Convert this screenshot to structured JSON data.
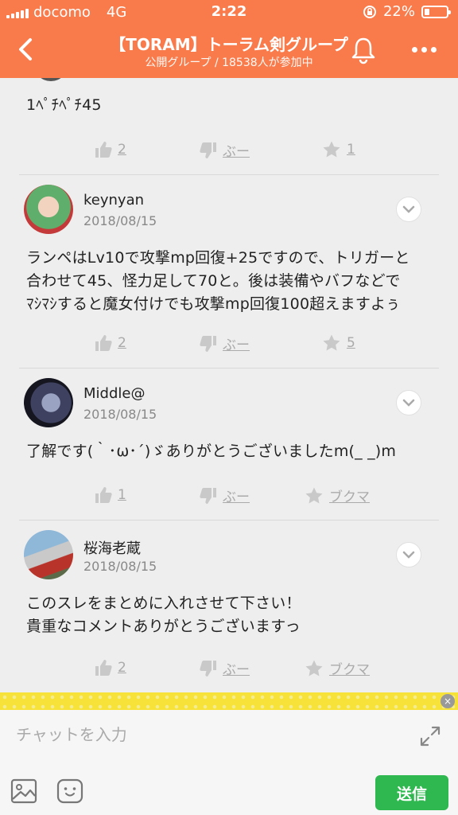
{
  "status": {
    "carrier": "docomo",
    "network": "4G",
    "time": "2:22",
    "battery": "22%",
    "battery_level": 0.22
  },
  "header": {
    "title": "【TORAM】トーラム剣グループ",
    "subtitle": "公開グループ / 18538人が参加中"
  },
  "posts": [
    {
      "text": "1ﾍﾟﾁﾍﾟﾁ45",
      "like_count": "2",
      "dislike_label": "ぶー",
      "bookmark_label": "1"
    },
    {
      "username": "keynyan",
      "date": "2018/08/15",
      "text_lines": [
        "ランペはLv10で攻撃mp回復+25ですので、トリガーと",
        "合わせて45、怪力足して70と。後は装備やバフなどで",
        "ﾏｼﾏｼすると魔女付けでも攻撃mp回復100超えますよぅ"
      ],
      "like_count": "2",
      "dislike_label": "ぶー",
      "bookmark_label": "5"
    },
    {
      "username": "Middle@",
      "date": "2018/08/15",
      "text_lines": [
        "了解です(｀･ω･´)ゞありがとうございましたm(_ _)m"
      ],
      "like_count": "1",
      "dislike_label": "ぶー",
      "bookmark_label": "ブクマ"
    },
    {
      "username": "桜海老蔵",
      "date": "2018/08/15",
      "text_lines": [
        "このスレをまとめに入れさせて下さい！",
        "貴重なコメントありがとうございますっ"
      ],
      "like_count": "2",
      "dislike_label": "ぶー",
      "bookmark_label": "ブクマ"
    }
  ],
  "chat": {
    "placeholder": "チャットを入力",
    "send_label": "送信"
  },
  "colors": {
    "accent": "#f97b4b",
    "send": "#2eb84f",
    "banner": "#f7e23a"
  },
  "icons": [
    "back-arrow-icon",
    "bell-icon",
    "more-icon",
    "thumbs-up-icon",
    "thumbs-down-icon",
    "star-icon",
    "chevron-down-icon",
    "expand-icon",
    "image-icon",
    "emoji-icon"
  ]
}
